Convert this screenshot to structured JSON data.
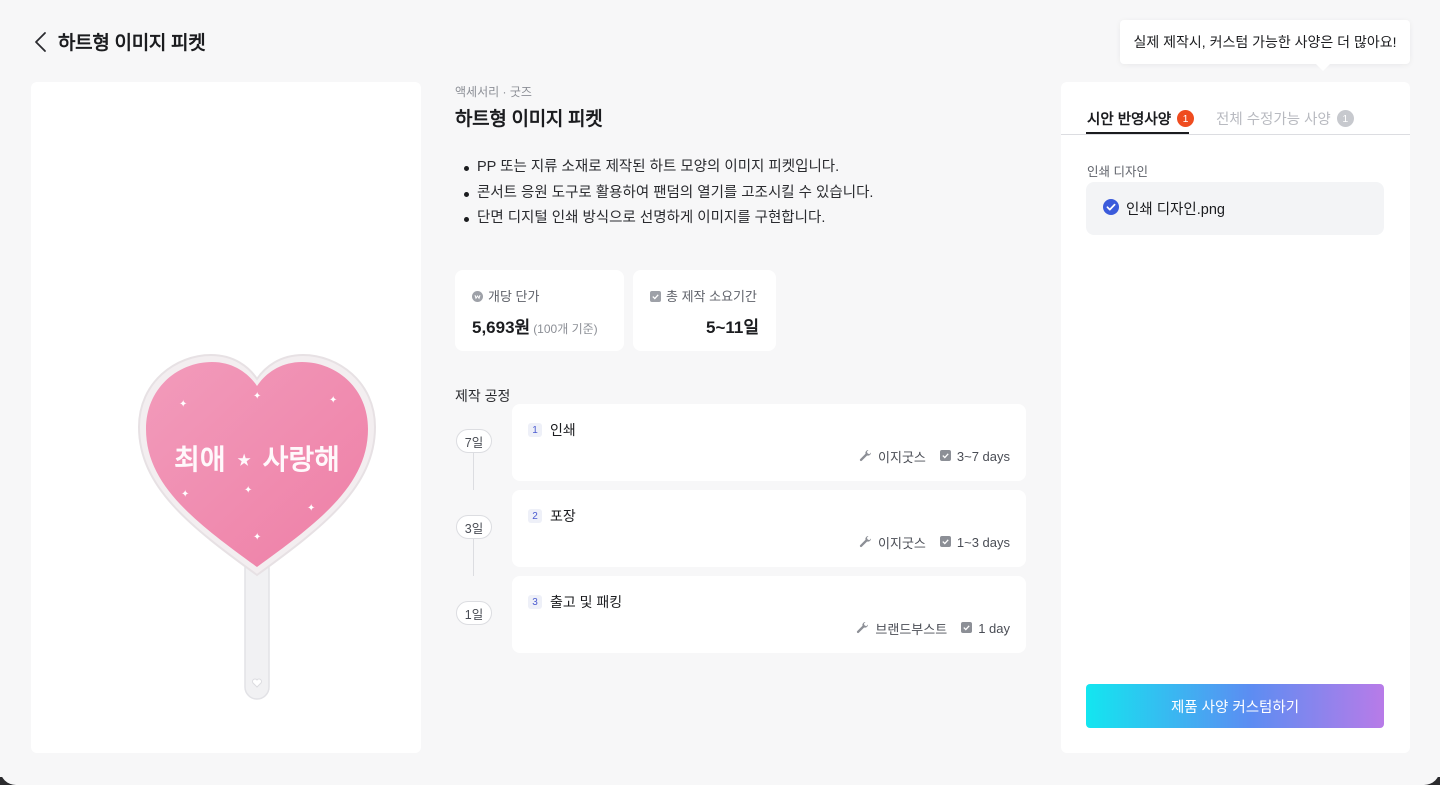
{
  "header": {
    "title": "하트형 이미지 피켓"
  },
  "tooltip": {
    "text": "실제 제작시, 커스텀 가능한 사양은 더 많아요!"
  },
  "product": {
    "category": "액세서리 · 굿즈",
    "name": "하트형 이미지 피켓",
    "image_text": "최애 ⋆ 사랑해",
    "descriptions": [
      "PP 또는 지류 소재로 제작된 하트 모양의 이미지 피켓입니다.",
      "콘서트 응원 도구로 활용하여 팬덤의 열기를 고조시킬 수 있습니다.",
      "단면 디지털 인쇄 방식으로 선명하게 이미지를 구현합니다."
    ]
  },
  "stats": {
    "price_label": "개당 단가",
    "price_value": "5,693원",
    "price_sub": "(100개 기준)",
    "period_label": "총 제작 소요기간",
    "period_value": "5~11일"
  },
  "process": {
    "title": "제작 공정",
    "steps": [
      {
        "num": "1",
        "name": "인쇄",
        "days": "7일",
        "vendor": "이지굿스",
        "duration": "3~7 days"
      },
      {
        "num": "2",
        "name": "포장",
        "days": "3일",
        "vendor": "이지굿스",
        "duration": "1~3 days"
      },
      {
        "num": "3",
        "name": "출고 및 패킹",
        "days": "1일",
        "vendor": "브랜드부스트",
        "duration": "1 day"
      }
    ]
  },
  "panel": {
    "tab_active": "시안 반영사양",
    "tab_active_count": "1",
    "tab_inactive": "전체 수정가능 사양",
    "tab_inactive_count": "1",
    "field_label": "인쇄 디자인",
    "file_name": "인쇄 디자인.png",
    "button_label": "제품 사양 커스텀하기"
  },
  "colors": {
    "accent_red": "#ef4c1f",
    "check_blue": "#3b5bdb",
    "heart_pink": "#f08db0"
  }
}
